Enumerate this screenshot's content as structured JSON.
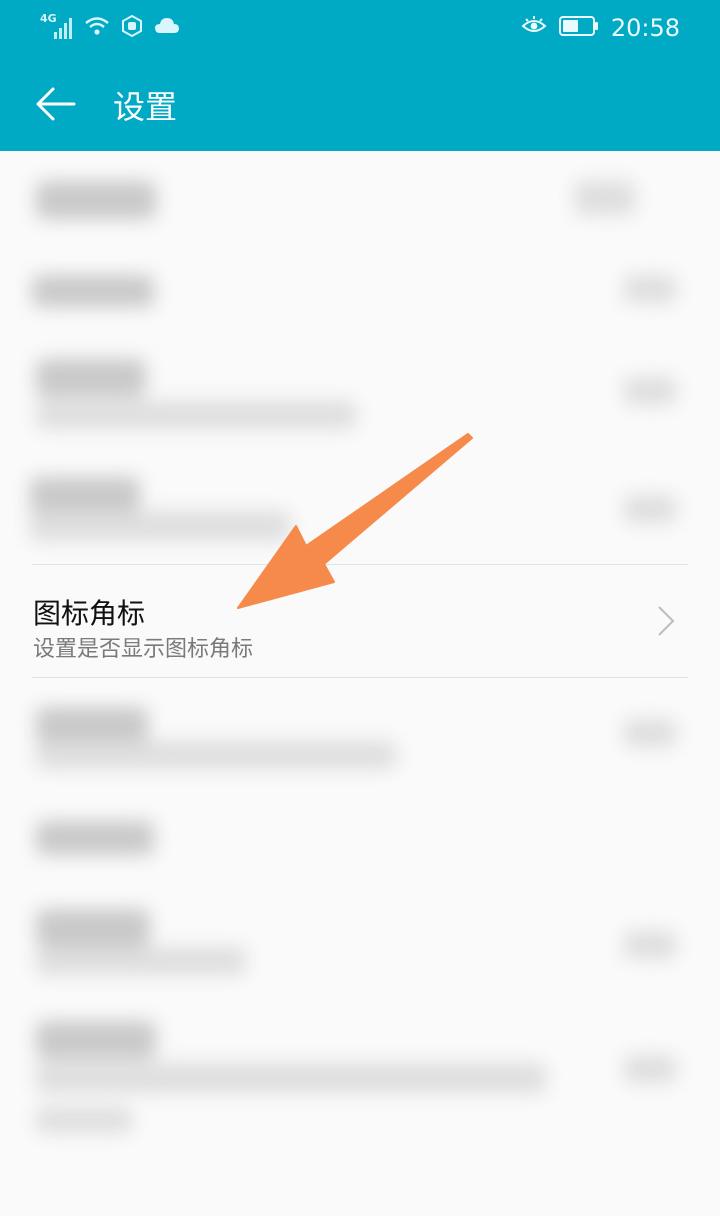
{
  "status_bar": {
    "network_label": "4G",
    "time": "20:58",
    "icons": [
      "signal-icon",
      "wifi-icon",
      "hand-icon",
      "cloud-icon",
      "eye-icon",
      "battery-icon"
    ]
  },
  "toolbar": {
    "title": "设置"
  },
  "settings": {
    "focused_item": {
      "title": "图标角标",
      "subtitle": "设置是否显示图标角标"
    }
  },
  "colors": {
    "appbar": "#00a9c4",
    "annotation_arrow": "#f58a4b"
  }
}
